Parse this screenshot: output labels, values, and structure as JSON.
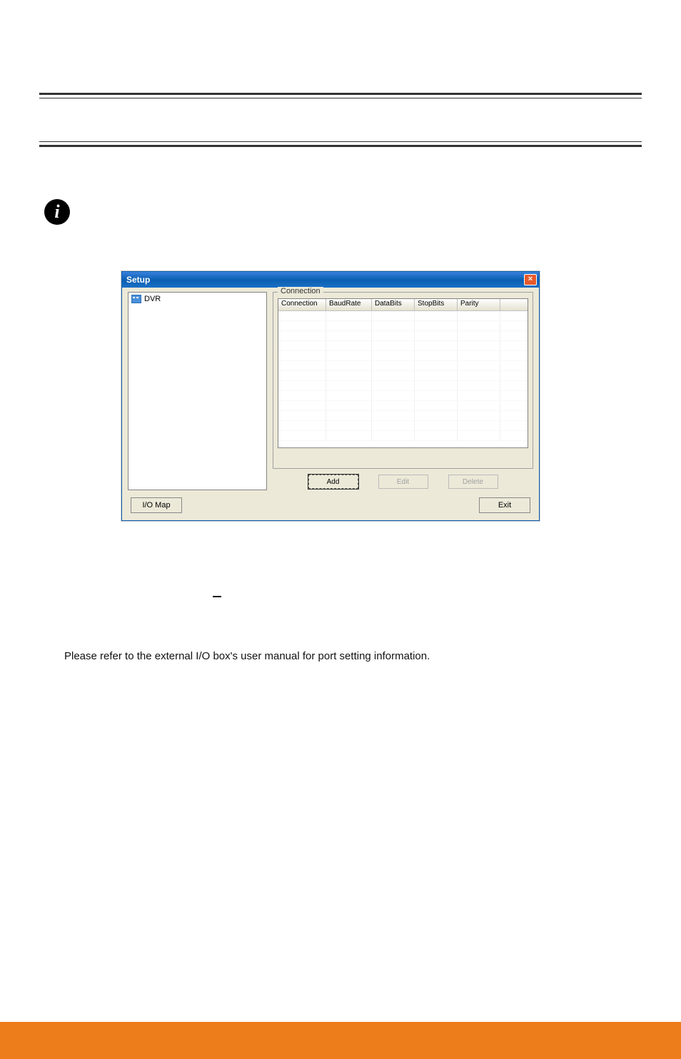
{
  "dialog": {
    "title": "Setup",
    "tree": {
      "item": "DVR"
    },
    "connection": {
      "legend": "Connection",
      "headers": [
        "Connection",
        "BaudRate",
        "DataBits",
        "StopBits",
        "Parity",
        ""
      ]
    },
    "buttons": {
      "add": "Add",
      "edit": "Edit",
      "delete": "Delete"
    },
    "bottom": {
      "iomap": "I/O Map",
      "exit": "Exit"
    }
  },
  "page_text": "Please refer to the external I/O box's user manual for port setting information.",
  "info_glyph": "i"
}
